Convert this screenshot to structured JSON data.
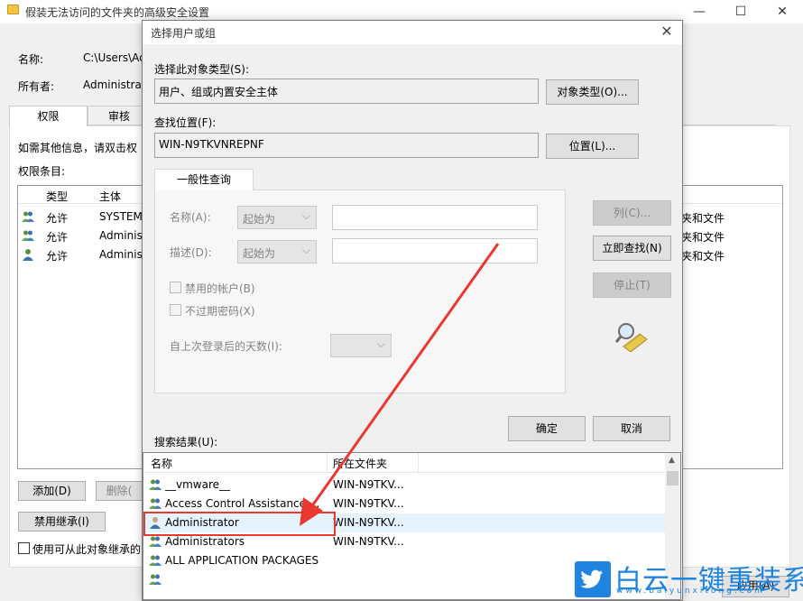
{
  "background_window": {
    "title": "假装无法访问的文件夹的高级安全设置",
    "name_label": "名称:",
    "name_value": "C:\\Users\\Ac",
    "owner_label": "所有者:",
    "owner_value": "Administra",
    "tabs": [
      "权限",
      "审核"
    ],
    "info_text": "如需其他信息，请双击权",
    "entries_label": "权限条目:",
    "columns": [
      "类型",
      "主体"
    ],
    "rows": [
      {
        "type": "允许",
        "principal": "SYSTEM",
        "applies": "夹和文件"
      },
      {
        "type": "允许",
        "principal": "Adminis",
        "applies": "夹和文件"
      },
      {
        "type": "允许",
        "principal": "Adminis",
        "applies": "夹和文件"
      }
    ],
    "add_button": "添加(D)",
    "remove_button": "删除(",
    "disable_inherit_button": "禁用继承(I)",
    "replace_checkbox_label": "使用可从此对象继承的",
    "apply_button": "应用(A)"
  },
  "dialog": {
    "title": "选择用户或组",
    "object_type_label": "选择此对象类型(S):",
    "object_type_value": "用户、组或内置安全主体",
    "object_types_button": "对象类型(O)...",
    "location_label": "查找位置(F):",
    "location_value": "WIN-N9TKVNREPNF",
    "locations_button": "位置(L)...",
    "tab_label": "一般性查询",
    "name_label": "名称(A):",
    "name_mode": "起始为",
    "desc_label": "描述(D):",
    "desc_mode": "起始为",
    "disabled_accounts": "禁用的帐户(B)",
    "non_expiring": "不过期密码(X)",
    "days_since_logon": "自上次登录后的天数(I):",
    "columns_button": "列(C)...",
    "find_now_button": "立即查找(N)",
    "stop_button": "停止(T)",
    "ok_button": "确定",
    "cancel_button": "取消",
    "results_label": "搜索结果(U):",
    "results_columns": [
      "名称",
      "所在文件夹"
    ],
    "results": [
      {
        "name": "__vmware__",
        "folder": "WIN-N9TKV..."
      },
      {
        "name": "Access Control Assistance ...",
        "folder": "WIN-N9TKV..."
      },
      {
        "name": "Administrator",
        "folder": "WIN-N9TKV..."
      },
      {
        "name": "Administrators",
        "folder": "WIN-N9TKV..."
      },
      {
        "name": "ALL APPLICATION PACKAGES",
        "folder": ""
      }
    ]
  },
  "watermark": {
    "text": "白云一键重装系统",
    "url": "www.baiyunxitong.com"
  },
  "colors": {
    "annotation_red": "#e8382f",
    "watermark_blue": "#1e84e0"
  }
}
